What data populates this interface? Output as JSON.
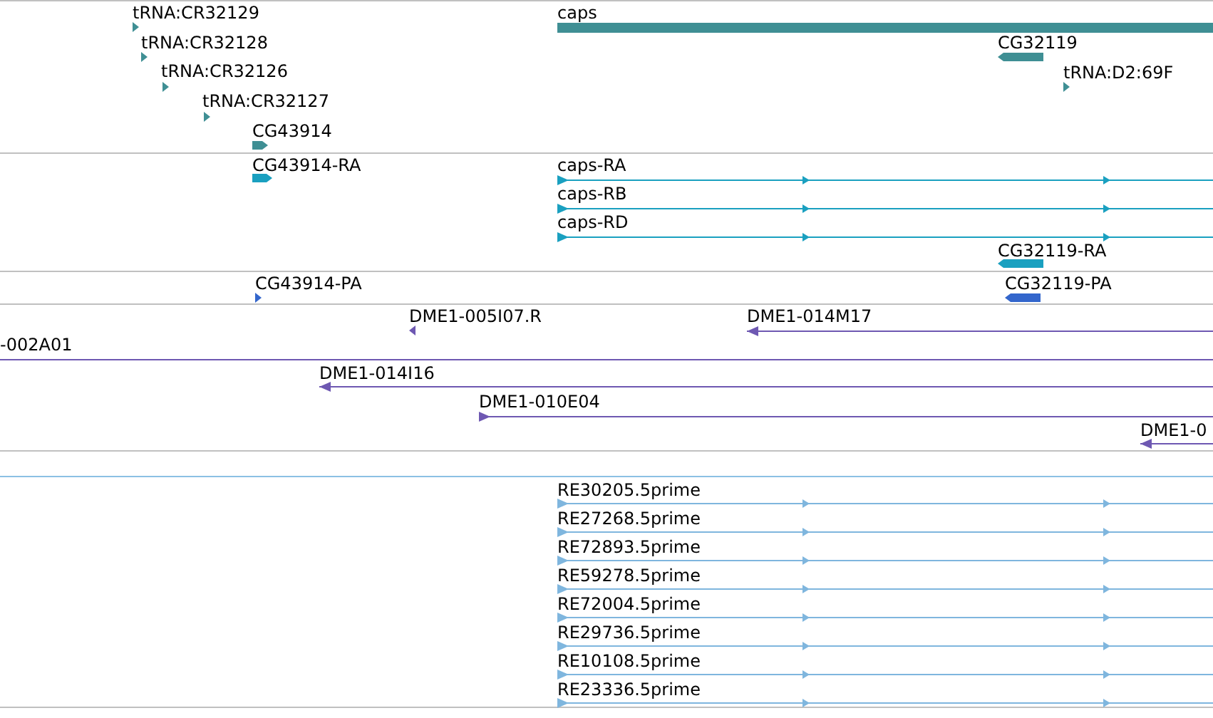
{
  "tracks": [
    {
      "kind": "genes",
      "features": [
        {
          "label": "tRNA:CR32129",
          "reverse": false
        },
        {
          "label": "tRNA:CR32128",
          "reverse": false
        },
        {
          "label": "tRNA:CR32126",
          "reverse": false
        },
        {
          "label": "tRNA:CR32127",
          "reverse": false
        },
        {
          "label": "CG43914",
          "reverse": false
        },
        {
          "label": "caps"
        },
        {
          "label": "CG32119",
          "reverse": true
        },
        {
          "label": "tRNA:D2:69F",
          "reverse": false
        }
      ]
    },
    {
      "kind": "transcripts",
      "features": [
        {
          "label": "CG43914-RA",
          "reverse": false
        },
        {
          "label": "caps-RA",
          "reverse": false
        },
        {
          "label": "caps-RB",
          "reverse": false
        },
        {
          "label": "caps-RD",
          "reverse": false
        },
        {
          "label": "CG32119-RA",
          "reverse": true
        }
      ]
    },
    {
      "kind": "proteins",
      "features": [
        {
          "label": "CG43914-PA",
          "reverse": false
        },
        {
          "label": "CG32119-PA",
          "reverse": true
        }
      ]
    },
    {
      "kind": "clones",
      "features": [
        {
          "label": "DME1-005I07.R",
          "reverse": true
        },
        {
          "label": "DME1-014M17",
          "reverse": true
        },
        {
          "label": "-002A01"
        },
        {
          "label": "DME1-014I16",
          "reverse": true
        },
        {
          "label": "DME1-010E04",
          "reverse": false
        },
        {
          "label": "DME1-0",
          "reverse": true
        }
      ]
    },
    {
      "kind": "empty"
    },
    {
      "kind": "ests",
      "features": [
        {
          "label": "RE30205.5prime",
          "reverse": false
        },
        {
          "label": "RE27268.5prime",
          "reverse": false
        },
        {
          "label": "RE72893.5prime",
          "reverse": false
        },
        {
          "label": "RE59278.5prime",
          "reverse": false
        },
        {
          "label": "RE72004.5prime",
          "reverse": false
        },
        {
          "label": "RE29736.5prime",
          "reverse": false
        },
        {
          "label": "RE10108.5prime",
          "reverse": false
        },
        {
          "label": "RE23336.5prime",
          "reverse": false
        }
      ]
    }
  ]
}
